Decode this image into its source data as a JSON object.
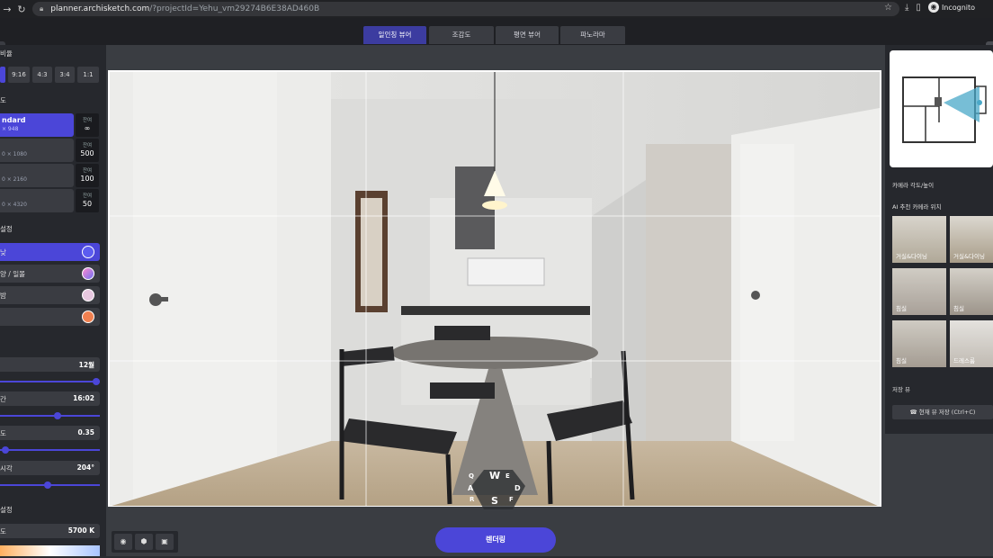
{
  "browser": {
    "url_host": "planner.archisketch.com",
    "url_path": "/?projectId=Yehu_vm29274B6E38AD460B",
    "incognito_label": "Incognito"
  },
  "tabs": [
    {
      "label": "일인칭 뷰어",
      "active": true
    },
    {
      "label": "조감도",
      "active": false
    },
    {
      "label": "평면 뷰어",
      "active": false
    },
    {
      "label": "파노라마",
      "active": false
    }
  ],
  "left": {
    "ratio_title": "비율",
    "ratios": [
      {
        "label": "",
        "active": true
      },
      {
        "label": "9:16",
        "active": false
      },
      {
        "label": "4:3",
        "active": false
      },
      {
        "label": "3:4",
        "active": false
      },
      {
        "label": "1:1",
        "active": false
      }
    ],
    "res_title": "도",
    "resolutions": [
      {
        "name": "ndard",
        "size": "× 948",
        "rem_label": "잔여",
        "rem_value": "∞",
        "active": true
      },
      {
        "name": "",
        "size": "0 × 1080",
        "rem_label": "잔여",
        "rem_value": "500",
        "active": false
      },
      {
        "name": "",
        "size": "0 × 2160",
        "rem_label": "잔여",
        "rem_value": "100",
        "active": false
      },
      {
        "name": "",
        "size": "0 × 4320",
        "rem_label": "잔여",
        "rem_value": "50",
        "active": false
      }
    ],
    "light_title": "설정",
    "lights": [
      {
        "label": "낮",
        "color": "#5c5cf0",
        "active": true
      },
      {
        "label": "양 / 일몰",
        "color": "#b080d8",
        "active": false
      },
      {
        "label": "밤",
        "color": "#e8c8e0",
        "active": false
      },
      {
        "label": "",
        "color": "#f08050",
        "active": false
      }
    ],
    "values": [
      {
        "label": "",
        "value": "12월",
        "fraction": 1.0
      },
      {
        "label": "간",
        "value": "16:02",
        "fraction": 0.58
      },
      {
        "label": "도",
        "value": "0.35",
        "fraction": 0.05
      },
      {
        "label": "시각",
        "value": "204°",
        "fraction": 0.48
      }
    ],
    "color_title": "설정",
    "temp_label": "도",
    "temp_value": "5700 K"
  },
  "right": {
    "camera_angle_label": "카메라 각도/높이",
    "ai_camera_title": "AI 추천 카메라 위치",
    "thumbs": [
      {
        "label": "거실&다이닝"
      },
      {
        "label": "거실&다이닝"
      },
      {
        "label": "침실"
      },
      {
        "label": "침실"
      },
      {
        "label": "침실"
      },
      {
        "label": "드레스룸"
      }
    ],
    "save_title": "저장 뷰",
    "save_button": "☎ 현재 뷰 저장 (Ctrl+C)"
  },
  "render_button": "렌더링",
  "wasd_keys": {
    "q": "Q",
    "w": "W",
    "e": "E",
    "a": "A",
    "d": "D",
    "r": "R",
    "s": "S",
    "f": "F"
  }
}
